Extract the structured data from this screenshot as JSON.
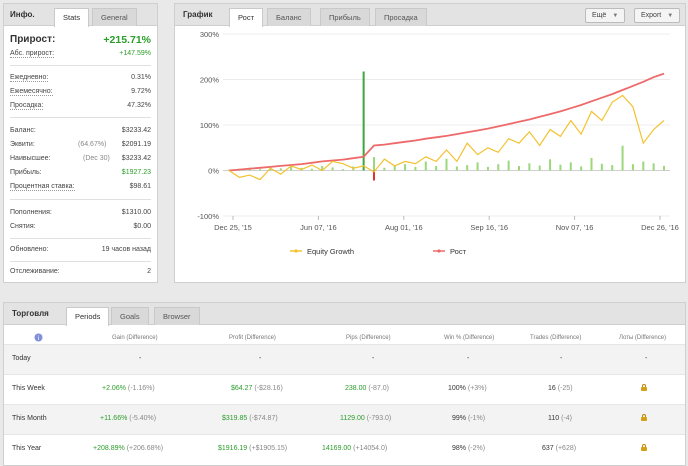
{
  "info": {
    "title": "Инфо.",
    "tabs": [
      "Stats",
      "General"
    ],
    "gain_label": "Прирост:",
    "gain_value": "+215.71%",
    "abs_gain_label": "Абс. прирост:",
    "abs_gain_value": "+147.59%",
    "daily_label": "Ежедневно:",
    "daily_value": "0.31%",
    "monthly_label": "Ежемесячно:",
    "monthly_value": "9.72%",
    "drawdown_label": "Просадка:",
    "drawdown_value": "47.32%",
    "balance_label": "Баланс:",
    "balance_value": "$3233.42",
    "equity_label": "Эквити:",
    "equity_pct": "(64.67%)",
    "equity_value": "$2091.19",
    "highest_label": "Наивысшее:",
    "highest_date": "(Dec 30)",
    "highest_value": "$3233.42",
    "profit_label": "Прибыль:",
    "profit_value": "$1927.23",
    "interest_label": "Процентная ставка:",
    "interest_value": "$98.61",
    "deposits_label": "Пополнения:",
    "deposits_value": "$1310.00",
    "withdrawals_label": "Снятия:",
    "withdrawals_value": "$0.00",
    "updated_label": "Обновлено:",
    "updated_value": "19 часов назад",
    "tracking_label": "Отслеживание:",
    "tracking_value": "2"
  },
  "chart_panel": {
    "title": "График",
    "tabs": [
      "Рост",
      "Баланс",
      "Прибыль",
      "Просадка"
    ],
    "btn_view": "Ещё",
    "btn_export": "Export"
  },
  "chart_data": {
    "type": "line",
    "title": "",
    "xlabel": "",
    "ylabel": "",
    "x_ticks": [
      "Dec 25, '15",
      "Jun 07, '16",
      "Aug 01, '16",
      "Sep 16, '16",
      "Nov 07, '16",
      "Dec 26, '16"
    ],
    "y_ticks": [
      "300%",
      "200%",
      "100%",
      "0%",
      "-100%"
    ],
    "ylim": [
      -100,
      300
    ],
    "grid": true,
    "legend_position": "bottom",
    "colors": {
      "equity": "#f2c230",
      "growth": "#ee6a6a",
      "bars": "#9bd87a",
      "spike": "#3aa83a",
      "neg": "#e03030"
    },
    "series": [
      {
        "name": "Рост",
        "values": [
          0,
          2,
          4,
          6,
          8,
          10,
          12,
          14,
          17,
          20,
          22,
          24,
          27,
          30,
          55,
          57,
          60,
          63,
          66,
          70,
          73,
          76,
          80,
          84,
          88,
          92,
          97,
          102,
          107,
          112,
          118,
          124,
          130,
          137,
          144,
          152,
          160,
          168,
          177,
          186,
          195,
          205,
          213
        ]
      },
      {
        "name": "Equity Growth",
        "values": [
          0,
          -15,
          -10,
          -20,
          5,
          -8,
          10,
          2,
          12,
          0,
          20,
          15,
          5,
          10,
          -3,
          25,
          10,
          20,
          15,
          30,
          20,
          45,
          20,
          60,
          35,
          50,
          40,
          70,
          60,
          85,
          55,
          90,
          75,
          110,
          80,
          130,
          110,
          150,
          165,
          140,
          60,
          90,
          110
        ]
      }
    ],
    "trade_bars": [
      2,
      4,
      6,
      3,
      8,
      5,
      12,
      6,
      4,
      10,
      7,
      3,
      9,
      220,
      30,
      6,
      12,
      14,
      8,
      20,
      10,
      26,
      9,
      12,
      18,
      8,
      14,
      22,
      10,
      16,
      11,
      25,
      13,
      18,
      9,
      28,
      15,
      12,
      55,
      14,
      20,
      16,
      10
    ]
  },
  "trading": {
    "title": "Торговля",
    "tabs": [
      "Periods",
      "Goals",
      "Browser"
    ],
    "headers": [
      "Gain (Difference)",
      "Profit (Difference)",
      "Pips (Difference)",
      "Win % (Difference)",
      "Trades (Difference)",
      "Лоты (Difference)"
    ],
    "rows": [
      {
        "label": "Today",
        "gain": "-",
        "gain_diff": "",
        "profit": "-",
        "profit_diff": "",
        "pips": "-",
        "pips_diff": "",
        "win": "-",
        "win_diff": "",
        "trades": "-",
        "trades_diff": "",
        "lots": "-",
        "locked": false
      },
      {
        "label": "This Week",
        "gain": "+2.06%",
        "gain_diff": "(-1.16%)",
        "profit": "$64.27",
        "profit_diff": "(-$28.16)",
        "pips": "238.00",
        "pips_diff": "(-87.0)",
        "win": "100%",
        "win_diff": "(+3%)",
        "trades": "16",
        "trades_diff": "(-25)",
        "lots": "",
        "locked": true
      },
      {
        "label": "This Month",
        "gain": "+11.66%",
        "gain_diff": "(-5.40%)",
        "profit": "$319.85",
        "profit_diff": "(-$74.87)",
        "pips": "1129.00",
        "pips_diff": "(-793.0)",
        "win": "99%",
        "win_diff": "(-1%)",
        "trades": "110",
        "trades_diff": "(-4)",
        "lots": "",
        "locked": true
      },
      {
        "label": "This Year",
        "gain": "+208.89%",
        "gain_diff": "(+206.68%)",
        "profit": "$1916.19",
        "profit_diff": "(+$1905.15)",
        "pips": "14169.00",
        "pips_diff": "(+14054.0)",
        "win": "98%",
        "win_diff": "(-2%)",
        "trades": "637",
        "trades_diff": "(+628)",
        "lots": "",
        "locked": true
      }
    ]
  }
}
